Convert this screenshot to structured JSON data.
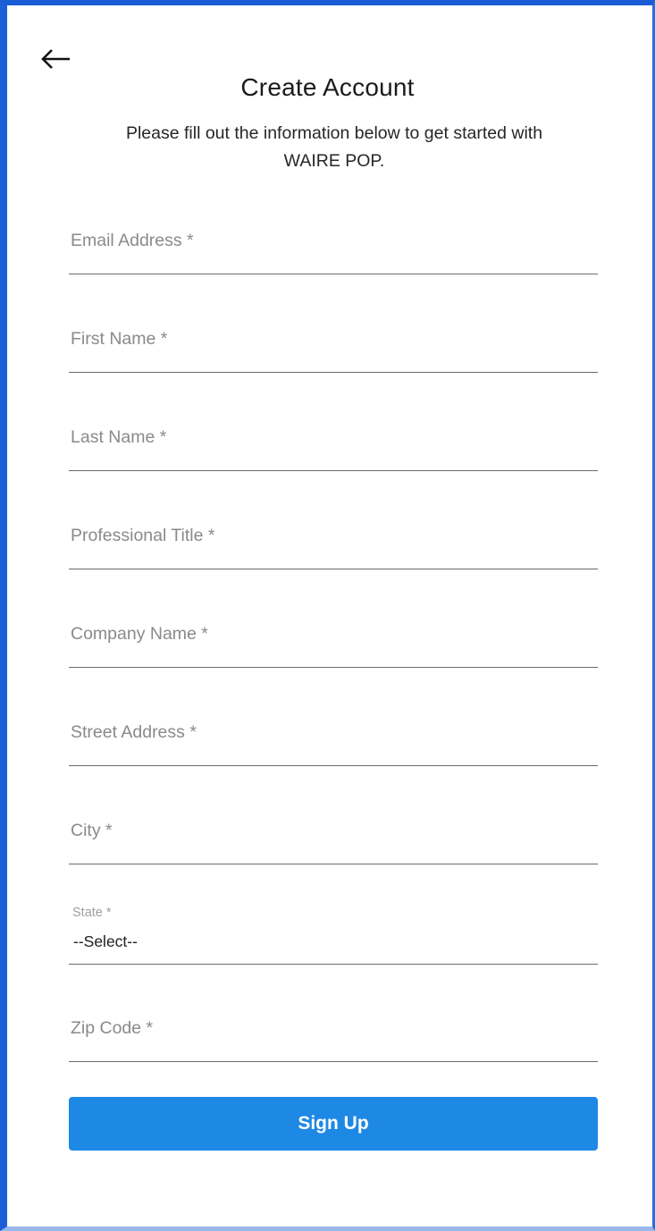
{
  "header": {
    "back_icon": "arrow-left-icon",
    "title": "Create Account",
    "subtitle_line1": "Please fill out the information below to get started with",
    "subtitle_line2": "WAIRE POP."
  },
  "form": {
    "email": {
      "placeholder": "Email Address *",
      "value": ""
    },
    "first_name": {
      "placeholder": "First Name *",
      "value": ""
    },
    "last_name": {
      "placeholder": "Last Name *",
      "value": ""
    },
    "professional_title": {
      "placeholder": "Professional Title *",
      "value": ""
    },
    "company_name": {
      "placeholder": "Company Name *",
      "value": ""
    },
    "street_address": {
      "placeholder": "Street Address *",
      "value": ""
    },
    "city": {
      "placeholder": "City *",
      "value": ""
    },
    "state": {
      "label": "State *",
      "selected": "--Select--"
    },
    "zip_code": {
      "placeholder": "Zip Code *",
      "value": ""
    }
  },
  "actions": {
    "signup_label": "Sign Up"
  },
  "colors": {
    "primary": "#1e88e5",
    "window_border": "#1a5bd6",
    "underline": "#6a6a6a",
    "placeholder": "#8a8a8a"
  }
}
